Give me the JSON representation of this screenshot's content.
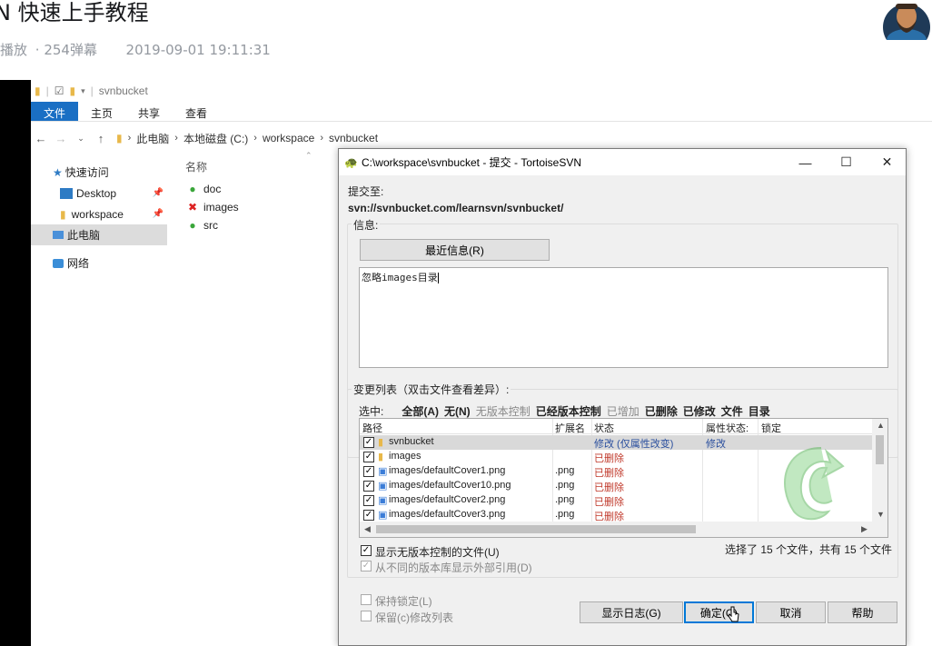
{
  "page": {
    "title": "N 快速上手教程",
    "plays": "播放",
    "danmaku": "· 254弹幕",
    "date": "2019-09-01 19:11:31"
  },
  "explorer": {
    "qat_title": "svnbucket",
    "ribbon_tabs": [
      "文件",
      "主页",
      "共享",
      "查看"
    ],
    "breadcrumbs": [
      "此电脑",
      "本地磁盘 (C:)",
      "workspace",
      "svnbucket"
    ],
    "nav_items": [
      {
        "label": "快速访问",
        "icon": "star-icon",
        "pinned": false
      },
      {
        "label": "Desktop",
        "icon": "desktop-icon",
        "pinned": true
      },
      {
        "label": "workspace",
        "icon": "folder-icon",
        "pinned": true
      },
      {
        "label": "此电脑",
        "icon": "computer-icon",
        "pinned": false
      },
      {
        "label": "网络",
        "icon": "network-icon",
        "pinned": false
      }
    ],
    "column_name": "名称",
    "files": [
      {
        "name": "doc",
        "status": "normal"
      },
      {
        "name": "images",
        "status": "deleted"
      },
      {
        "name": "src",
        "status": "normal"
      }
    ]
  },
  "dialog": {
    "title": "C:\\workspace\\svnbucket - 提交 - TortoiseSVN",
    "commit_to_label": "提交至:",
    "commit_to_url": "svn://svnbucket.com/learnsvn/svnbucket/",
    "info_label": "信息:",
    "recent_msgs_button": "最近信息(R)",
    "message": "忽略images目录",
    "changes_label": "变更列表（双击文件查看差异）:",
    "select_label": "选中:",
    "select_options": [
      {
        "label": "全部(A)",
        "enabled": true
      },
      {
        "label": "无(N)",
        "enabled": true
      },
      {
        "label": "无版本控制",
        "enabled": false
      },
      {
        "label": "已经版本控制",
        "enabled": true
      },
      {
        "label": "已增加",
        "enabled": false
      },
      {
        "label": "已删除",
        "enabled": true
      },
      {
        "label": "已修改",
        "enabled": true
      },
      {
        "label": "文件",
        "enabled": true
      },
      {
        "label": "目录",
        "enabled": true
      }
    ],
    "columns": [
      "路径",
      "扩展名",
      "状态",
      "属性状态:",
      "锁定"
    ],
    "rows": [
      {
        "path": "svnbucket",
        "ext": "",
        "status": "修改 (仅属性改变)",
        "prop_status": "修改",
        "lock": "",
        "type": "folder",
        "selected": true
      },
      {
        "path": "images",
        "ext": "",
        "status": "已删除",
        "prop_status": "",
        "lock": "",
        "type": "folder",
        "selected": false
      },
      {
        "path": "images/defaultCover1.png",
        "ext": ".png",
        "status": "已删除",
        "prop_status": "",
        "lock": "",
        "type": "file",
        "selected": false
      },
      {
        "path": "images/defaultCover10.png",
        "ext": ".png",
        "status": "已删除",
        "prop_status": "",
        "lock": "",
        "type": "file",
        "selected": false
      },
      {
        "path": "images/defaultCover2.png",
        "ext": ".png",
        "status": "已删除",
        "prop_status": "",
        "lock": "",
        "type": "file",
        "selected": false
      },
      {
        "path": "images/defaultCover3.png",
        "ext": ".png",
        "status": "已删除",
        "prop_status": "",
        "lock": "",
        "type": "file",
        "selected": false
      }
    ],
    "show_unversioned": "显示无版本控制的文件(U)",
    "show_externals": "从不同的版本库显示外部引用(D)",
    "selection_summary": "选择了 15 个文件，共有 15 个文件",
    "keep_locks": "保持锁定(L)",
    "keep_changelists": "保留(c)修改列表",
    "btn_show_log": "显示日志(G)",
    "btn_ok": "确定(O)",
    "btn_cancel": "取消",
    "btn_help": "帮助"
  },
  "colors": {
    "accent": "#1a6fc4",
    "deleted": "#c0392b",
    "modified": "#2a4f9e"
  }
}
